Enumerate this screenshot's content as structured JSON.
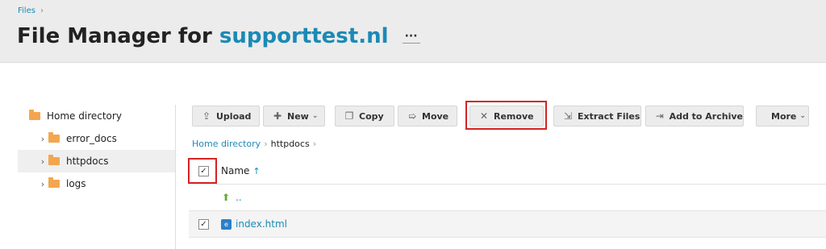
{
  "breadcrumb_top": {
    "label": "Files",
    "separator": "›"
  },
  "title": {
    "prefix": "File Manager for",
    "domain": "supporttest.nl",
    "more_label": "···"
  },
  "tree": {
    "items": [
      {
        "label": "Home directory",
        "chevron": ""
      },
      {
        "label": "error_docs",
        "chevron": "›"
      },
      {
        "label": "httpdocs",
        "chevron": "›",
        "active": true
      },
      {
        "label": "logs",
        "chevron": "›"
      }
    ]
  },
  "toolbar": {
    "upload": "Upload",
    "new": "New",
    "copy": "Copy",
    "move": "Move",
    "remove": "Remove",
    "extract": "Extract Files",
    "archive": "Add to Archive",
    "more": "More"
  },
  "path": {
    "home": "Home directory",
    "current": "httpdocs",
    "separator": "›"
  },
  "list": {
    "header": {
      "name_label": "Name",
      "sort_icon": "↑"
    },
    "rows": [
      {
        "name": "..",
        "type": "parent"
      },
      {
        "name": "index.html",
        "type": "file"
      }
    ]
  },
  "colors": {
    "accent": "#1b8ab5",
    "highlight": "#d42323",
    "folder": "#f3a64f"
  }
}
